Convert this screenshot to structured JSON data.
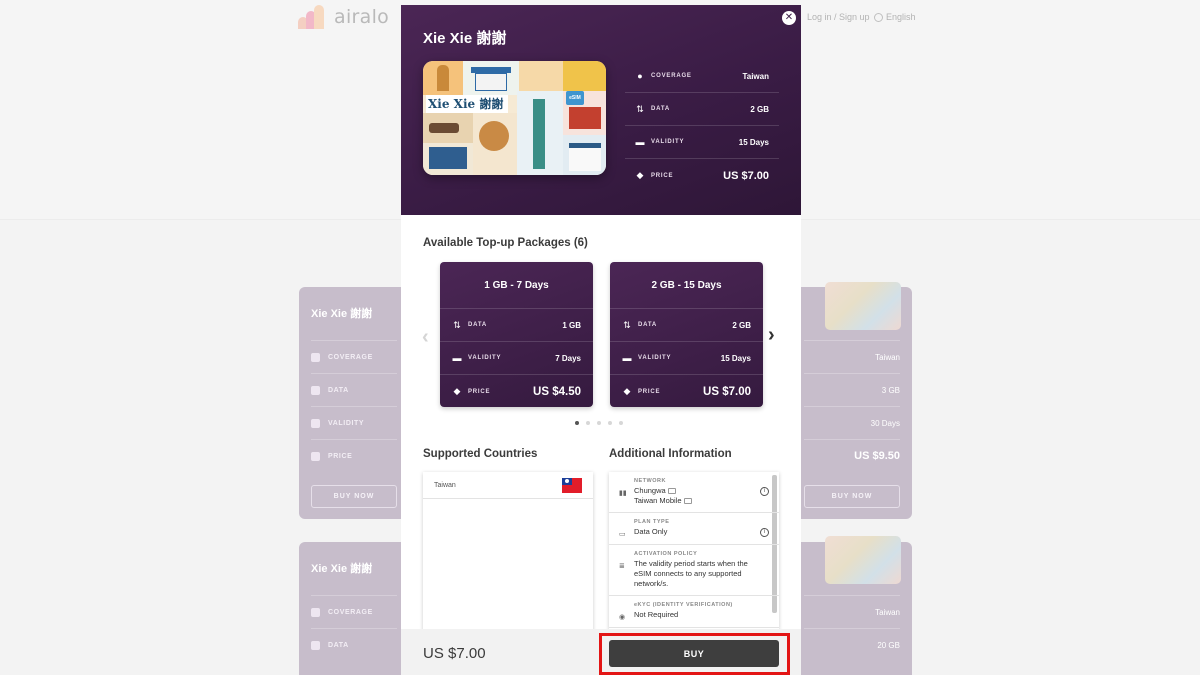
{
  "colors": {
    "brand_purple": "#3a1c45",
    "buy_button": "#3e3e3e",
    "highlight": "#e31515"
  },
  "background": {
    "logo_text": "airalo",
    "login_link": "Log in / Sign up",
    "language": "English",
    "cards": [
      {
        "title": "Xie Xie 謝謝",
        "rows": [
          {
            "label": "COVERAGE",
            "value": "Taiwan"
          },
          {
            "label": "DATA",
            "value": "3 GB"
          },
          {
            "label": "VALIDITY",
            "value": "30 Days"
          },
          {
            "label": "PRICE",
            "value": "US $9.50"
          }
        ],
        "buy_label": "BUY NOW"
      },
      {
        "title": "Xie Xie 謝謝",
        "rows": [
          {
            "label": "COVERAGE",
            "value": "Taiwan"
          },
          {
            "label": "DATA",
            "value": "20 GB"
          }
        ]
      }
    ]
  },
  "modal": {
    "title": "Xie Xie 謝謝",
    "card_text": "Xie Xie 謝謝",
    "card_chip": "eSIM",
    "specs": [
      {
        "icon": "globe-icon",
        "label": "COVERAGE",
        "value": "Taiwan"
      },
      {
        "icon": "data-arrows-icon",
        "label": "DATA",
        "value": "2 GB"
      },
      {
        "icon": "calendar-icon",
        "label": "VALIDITY",
        "value": "15 Days"
      },
      {
        "icon": "price-tag-icon",
        "label": "PRICE",
        "value": "US $7.00"
      }
    ],
    "topup_title": "Available Top-up Packages (6)",
    "packages": [
      {
        "title": "1 GB - 7 Days",
        "rows": [
          {
            "label": "DATA",
            "value": "1 GB"
          },
          {
            "label": "VALIDITY",
            "value": "7 Days"
          },
          {
            "label": "PRICE",
            "value": "US $4.50"
          }
        ]
      },
      {
        "title": "2 GB - 15 Days",
        "rows": [
          {
            "label": "DATA",
            "value": "2 GB"
          },
          {
            "label": "VALIDITY",
            "value": "15 Days"
          },
          {
            "label": "PRICE",
            "value": "US $7.00"
          }
        ]
      }
    ],
    "carousel": {
      "active_index": 0,
      "total": 5
    },
    "supported_countries_title": "Supported Countries",
    "countries": [
      "Taiwan"
    ],
    "additional_info_title": "Additional Information",
    "info": [
      {
        "key": "NETWORK",
        "lines": [
          "Chungwa",
          "Taiwan Mobile"
        ]
      },
      {
        "key": "PLAN TYPE",
        "lines": [
          "Data Only"
        ]
      },
      {
        "key": "ACTIVATION POLICY",
        "lines": [
          "The validity period starts when the eSIM connects to any supported network/s."
        ]
      },
      {
        "key": "eKYC (IDENTITY VERIFICATION)",
        "lines": [
          "Not Required"
        ]
      }
    ],
    "footer": {
      "price": "US $7.00",
      "buy_label": "BUY"
    }
  }
}
